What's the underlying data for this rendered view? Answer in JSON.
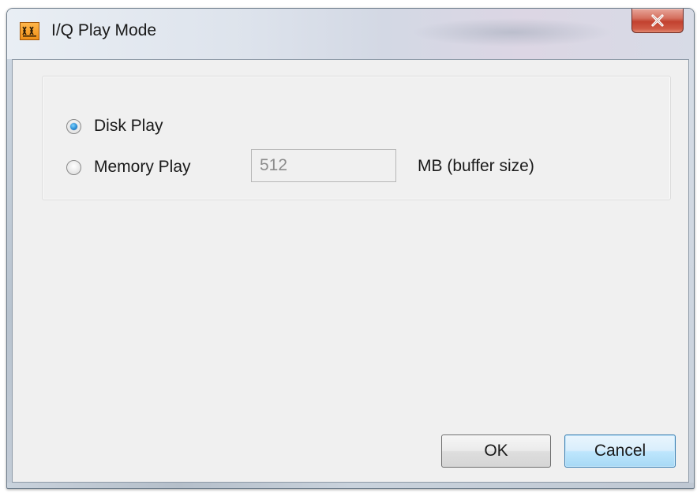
{
  "window": {
    "title": "I/Q Play Mode",
    "app_icon": "xx-app-icon",
    "close_icon": "close-x-icon"
  },
  "play_mode": {
    "options": [
      {
        "label": "Disk Play",
        "checked": true
      },
      {
        "label": "Memory Play",
        "checked": false
      }
    ],
    "buffer_size": {
      "value": "512",
      "unit_label": "MB (buffer size)",
      "enabled": false
    }
  },
  "buttons": {
    "ok_label": "OK",
    "cancel_label": "Cancel"
  },
  "colors": {
    "radio_selected": "#2c8fd6",
    "close_button": "#c2412f",
    "default_button_border": "#3c7fb1"
  }
}
